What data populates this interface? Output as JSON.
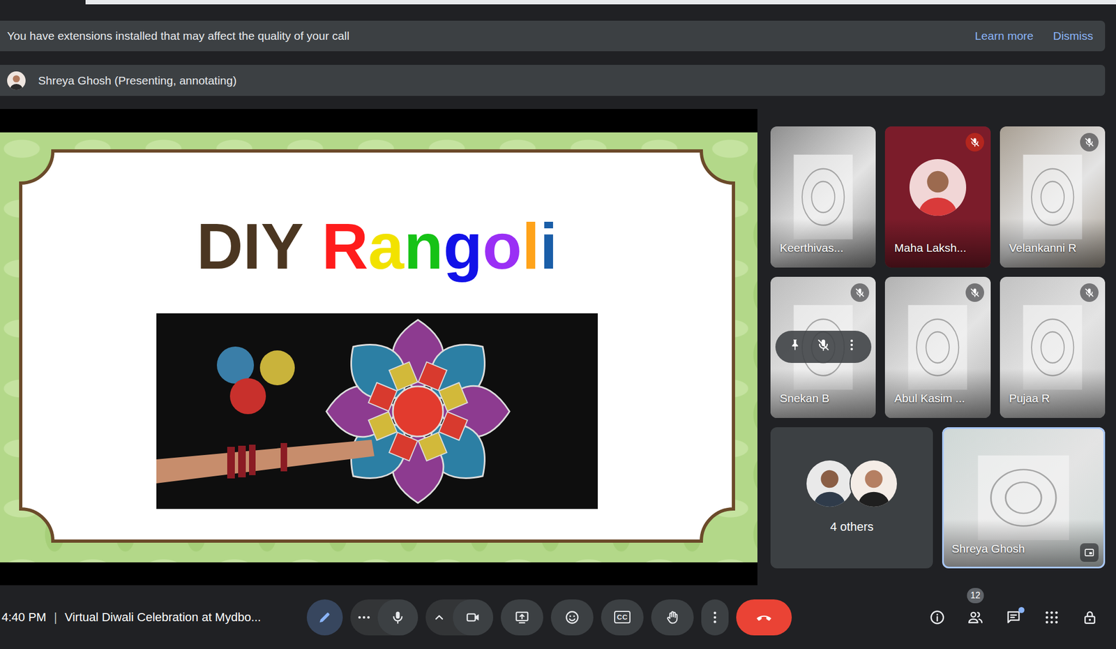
{
  "notification": {
    "message": "You have extensions installed that may affect the quality of your call",
    "actions": [
      "Learn more",
      "Dismiss"
    ]
  },
  "presenter": {
    "label": "Shreya Ghosh (Presenting, annotating)"
  },
  "slide": {
    "title_words": [
      {
        "letters": [
          {
            "text": "DIY",
            "color": "#4b3621"
          }
        ]
      },
      {
        "letters": [
          {
            "text": "R",
            "color": "#ff1c1c"
          },
          {
            "text": "a",
            "color": "#f2e200"
          },
          {
            "text": "n",
            "color": "#16c216"
          },
          {
            "text": "g",
            "color": "#1212e8"
          },
          {
            "text": "o",
            "color": "#9a2ff5"
          },
          {
            "text": "l",
            "color": "#ffa31a"
          },
          {
            "text": "i",
            "color": "#1a5ea8"
          }
        ]
      }
    ]
  },
  "participants": [
    {
      "name": "Keerthivas...",
      "kind": "video",
      "muted": false,
      "hovered": false,
      "highlighted": false,
      "color": "#8e8e8e"
    },
    {
      "name": "Maha Laksh...",
      "kind": "avatar",
      "muted": true,
      "hovered": false,
      "highlighted": false,
      "color": "#7b1c2a"
    },
    {
      "name": "Velankanni R",
      "kind": "video",
      "muted": true,
      "hovered": false,
      "highlighted": false,
      "color": "#a89f93"
    },
    {
      "name": "Snekan B",
      "kind": "video",
      "muted": true,
      "hovered": true,
      "highlighted": false,
      "color": "#bdbdbd"
    },
    {
      "name": "Abul Kasim ...",
      "kind": "video",
      "muted": true,
      "hovered": false,
      "highlighted": false,
      "color": "#b2b2b2"
    },
    {
      "name": "Pujaa R",
      "kind": "video",
      "muted": true,
      "hovered": false,
      "highlighted": false,
      "color": "#c2c2c2"
    },
    {
      "name": "Shreya Ghosh",
      "kind": "video",
      "muted": false,
      "hovered": false,
      "highlighted": true,
      "color": "#cfd8d6"
    }
  ],
  "others": {
    "label": "4 others"
  },
  "meeting": {
    "time": "4:40 PM",
    "separator": "|",
    "title": "Virtual Diwali Celebration at Mydbo..."
  },
  "controls": [
    {
      "kind": "annotate",
      "active": true
    },
    {
      "kind": "more-h",
      "active": false
    },
    {
      "kind": "mic",
      "active": false
    },
    {
      "kind": "chevron",
      "active": false
    },
    {
      "kind": "camera",
      "active": false
    },
    {
      "kind": "present",
      "active": false
    },
    {
      "kind": "reactions",
      "active": false
    },
    {
      "kind": "captions",
      "active": false,
      "label": "CC"
    },
    {
      "kind": "hand",
      "active": false
    },
    {
      "kind": "more-v",
      "active": false
    },
    {
      "kind": "end-call",
      "active": false
    }
  ],
  "side_controls": [
    {
      "kind": "info"
    },
    {
      "kind": "people",
      "badge": "12"
    },
    {
      "kind": "chat",
      "unread": true
    },
    {
      "kind": "apps"
    },
    {
      "kind": "host"
    }
  ]
}
